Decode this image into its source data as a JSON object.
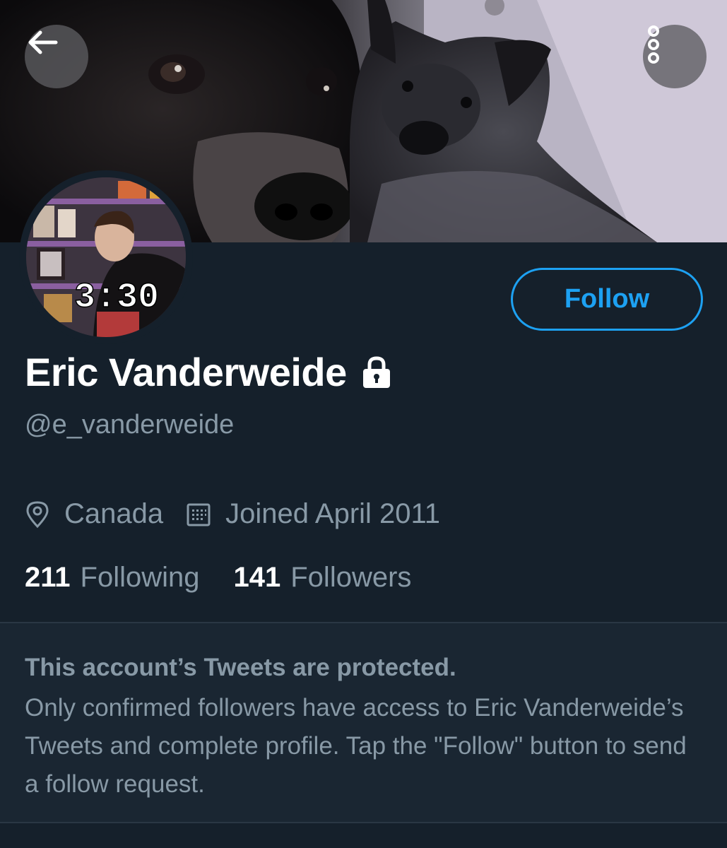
{
  "header": {
    "back_icon": "arrow-left-icon",
    "more_icon": "more-vertical-icon"
  },
  "profile": {
    "name": "Eric Vanderweide",
    "handle": "@e_vanderweide",
    "protected_icon": "lock-icon",
    "location": "Canada",
    "location_icon": "location-pin-icon",
    "joined": "Joined April 2011",
    "joined_icon": "calendar-icon",
    "avatar_clock_text": "3:30"
  },
  "actions": {
    "follow_label": "Follow"
  },
  "stats": {
    "following_count": "211",
    "following_label": "Following",
    "followers_count": "141",
    "followers_label": "Followers"
  },
  "protected_notice": {
    "title": "This account’s Tweets are protected.",
    "body": "Only confirmed followers have access to Eric Vanderweide’s Tweets and complete profile. Tap the \"Follow\" button to send a follow request."
  },
  "colors": {
    "background": "#15202b",
    "accent": "#1da1f2",
    "secondary_text": "#8899a6",
    "primary_text": "#ffffff"
  }
}
